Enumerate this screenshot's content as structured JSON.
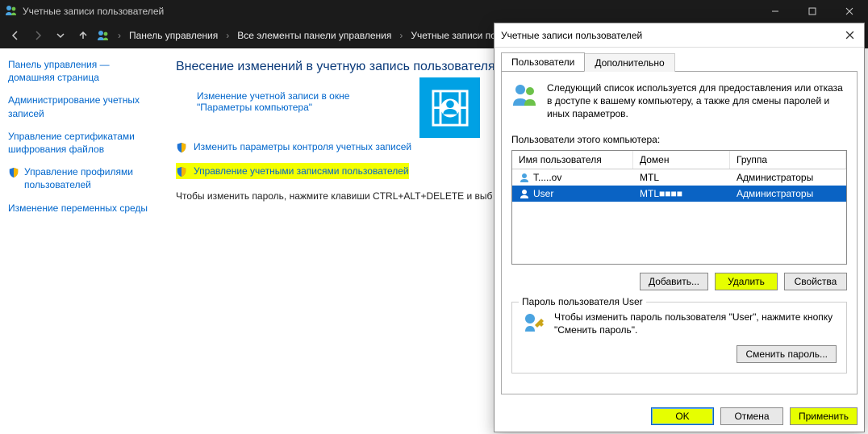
{
  "window": {
    "title": "Учетные записи пользователей"
  },
  "breadcrumbs": {
    "items": [
      "Панель управления",
      "Все элементы панели управления",
      "Учетные записи поль..."
    ]
  },
  "sidebar": {
    "items": [
      {
        "label": "Панель управления — домашняя страница"
      },
      {
        "label": "Администрирование учетных записей"
      },
      {
        "label": "Управление сертификатами шифрования файлов"
      },
      {
        "label": "Управление профилями пользователей"
      },
      {
        "label": "Изменение переменных среды"
      }
    ]
  },
  "main": {
    "heading": "Внесение изменений в учетную запись пользователя",
    "tasks": {
      "change_in_params_a": "Изменение учетной записи в окне",
      "change_in_params_b": "\"Параметры компьютера\"",
      "uac": "Изменить параметры контроля учетных записей",
      "manage_accounts": "Управление учетными записями пользователей"
    },
    "hint": "Чтобы изменить пароль, нажмите клавиши CTRL+ALT+DELETE и выб"
  },
  "dialog": {
    "title": "Учетные записи пользователей",
    "tabs": {
      "users": "Пользователи",
      "advanced": "Дополнительно"
    },
    "description": "Следующий список используется для предоставления или отказа в доступе к вашему компьютеру, а также для смены паролей и иных параметров.",
    "list_label": "Пользователи этого компьютера:",
    "columns": {
      "user": "Имя пользователя",
      "domain": "Домен",
      "group": "Группа"
    },
    "rows": [
      {
        "user": "T.....ov",
        "domain": "MTL",
        "group": "Администраторы"
      },
      {
        "user": "User",
        "domain": "MTL■■■■",
        "group": "Администраторы"
      }
    ],
    "buttons": {
      "add": "Добавить...",
      "remove": "Удалить",
      "props": "Свойства"
    },
    "password": {
      "legend": "Пароль пользователя User",
      "text": "Чтобы изменить пароль пользователя \"User\", нажмите кнопку \"Сменить пароль\".",
      "change": "Сменить пароль..."
    },
    "footer": {
      "ok": "OK",
      "cancel": "Отмена",
      "apply": "Применить"
    }
  }
}
